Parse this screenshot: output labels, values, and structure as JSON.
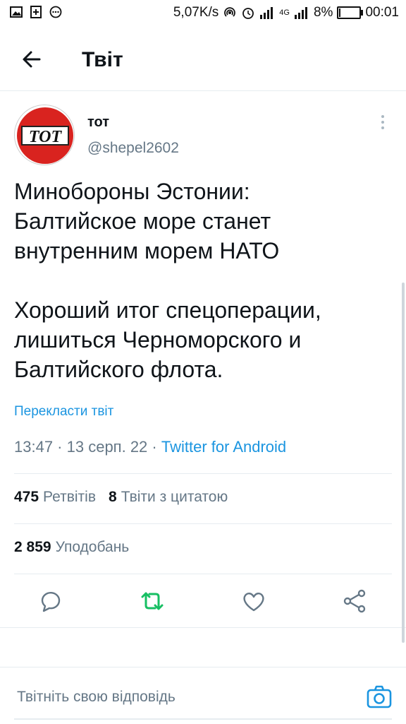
{
  "status_bar": {
    "speed": "5,07K/s",
    "network": "4G",
    "battery": "8%",
    "battery_level": 0.08,
    "time": "00:01"
  },
  "header": {
    "title": "Твіт"
  },
  "tweet": {
    "avatar_text": "TOT",
    "author_name": "тот",
    "author_handle": "@shepel2602",
    "text": "Минобороны Эстонии:\nБалтийское море станет\nвнутренним морем НАТО\n\nХороший итог спецоперации,\nлишиться Черноморского и\nБалтийского флота.",
    "translate_label": "Перекласти твіт",
    "time": "13:47",
    "date": "13 серп. 22",
    "source": "Twitter for Android",
    "separator": " · "
  },
  "stats": {
    "retweets_count": "475",
    "retweets_label": "Ретвітів",
    "quotes_count": "8",
    "quotes_label": "Твіти з цитатою",
    "likes_count": "2 859",
    "likes_label": "Уподобань"
  },
  "actions": {
    "icons": [
      "reply-icon",
      "retweet-icon",
      "like-icon",
      "share-icon"
    ],
    "retweet_color": "#17bf63",
    "icon_color": "#657786"
  },
  "reply": {
    "placeholder": "Твітніть свою відповідь"
  },
  "colors": {
    "link": "#1b95e0",
    "secondary": "#657786",
    "text": "#0f1419",
    "divider": "#e6ecf0"
  }
}
